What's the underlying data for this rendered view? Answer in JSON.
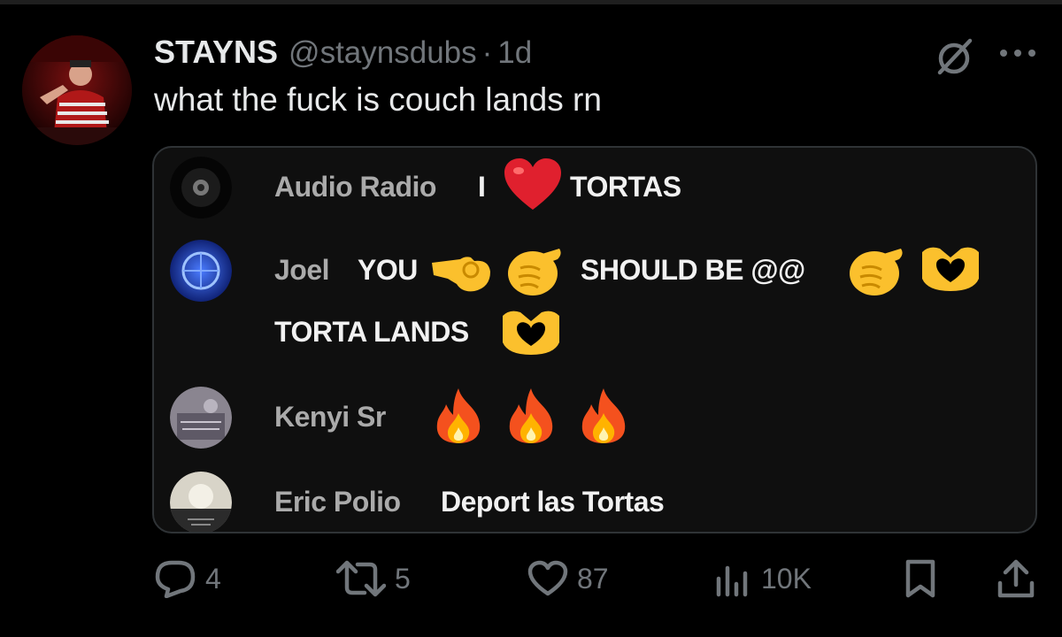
{
  "tweet": {
    "display_name": "STAYNS",
    "handle": "@staynsdubs",
    "separator": "·",
    "age": "1d",
    "text": "what the fuck is couch lands rn"
  },
  "icons": {
    "grok": "grok-icon",
    "more": "more-icon",
    "reply": "reply-icon",
    "retweet": "retweet-icon",
    "like": "heart-icon",
    "views": "views-icon",
    "bookmark": "bookmark-icon",
    "share": "share-icon"
  },
  "chat": [
    {
      "name": "Audio Radio",
      "text_parts": [
        "I",
        "TORTAS"
      ],
      "emojis": [
        "red-heart"
      ]
    },
    {
      "name": "Joel",
      "text_parts": [
        "YOU",
        "SHOULD BE @@",
        "TORTA LANDS"
      ],
      "emojis": [
        "pinching-hand",
        "backhand-index-pointing",
        "backhand-index-pointing",
        "heart-hands",
        "heart-hands"
      ]
    },
    {
      "name": "Kenyi Sr",
      "text_parts": [],
      "emojis": [
        "fire",
        "fire",
        "fire"
      ]
    },
    {
      "name": "Eric Polio",
      "text_parts": [
        "Deport las Tortas"
      ],
      "emojis": []
    }
  ],
  "actions": {
    "replies": "4",
    "reposts": "5",
    "likes": "87",
    "views": "10K"
  },
  "colors": {
    "background": "#000000",
    "primary_text": "#e7e9ea",
    "secondary_text": "#71767b",
    "card_border": "#2f3336",
    "chat_name": "#aaaaaa",
    "heart": "#e0202e",
    "emoji_yellow": "#fbc02d",
    "fire_orange": "#f4511e"
  }
}
